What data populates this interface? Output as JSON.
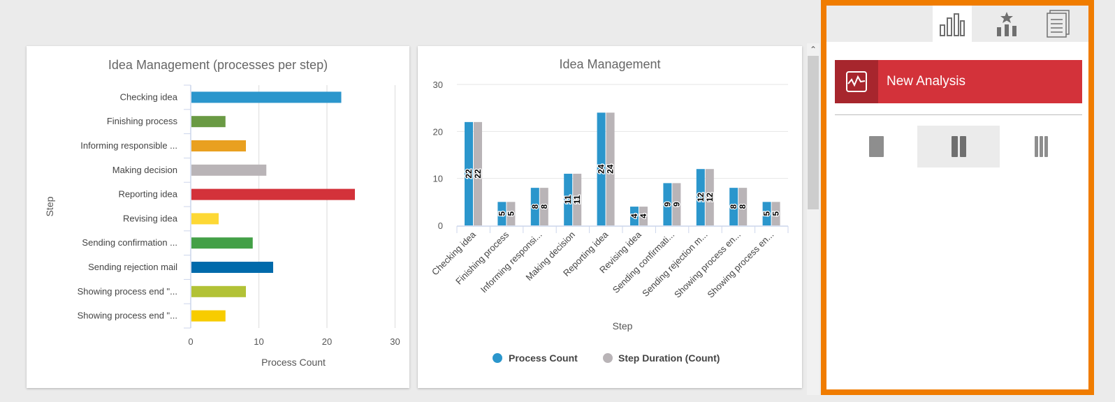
{
  "left_chart": {
    "title": "Idea Management (processes per step)",
    "xlabel": "Process Count",
    "ylabel": "Step",
    "xticks": [
      "0",
      "10",
      "20",
      "30"
    ]
  },
  "right_chart": {
    "title": "Idea Management",
    "xlabel": "Step",
    "yticks": [
      "0",
      "10",
      "20",
      "30"
    ],
    "legend": [
      "Process Count",
      "Step Duration (Count)"
    ]
  },
  "chart_data": [
    {
      "type": "bar",
      "orientation": "horizontal",
      "title": "Idea Management (processes per step)",
      "xlabel": "Process Count",
      "ylabel": "Step",
      "xlim": [
        0,
        30
      ],
      "grid": true,
      "categories": [
        "Checking idea",
        "Finishing process",
        "Informing responsible ...",
        "Making decision",
        "Reporting idea",
        "Revising idea",
        "Sending confirmation ...",
        "Sending rejection mail",
        "Showing process end \"...",
        "Showing process end \"..."
      ],
      "values": [
        22,
        5,
        8,
        11,
        24,
        4,
        9,
        12,
        8,
        5
      ],
      "colors": [
        "#2b96cc",
        "#6a9a44",
        "#e9a020",
        "#b9b4b7",
        "#d3323a",
        "#fdd835",
        "#43a047",
        "#006aab",
        "#b2c236",
        "#f7cc00"
      ]
    },
    {
      "type": "bar",
      "orientation": "vertical",
      "title": "Idea Management",
      "xlabel": "Step",
      "ylim": [
        0,
        30
      ],
      "grid": true,
      "legend_placement": "bottom",
      "categories": [
        "Checking idea",
        "Finishing process",
        "Informing responsi...",
        "Making decision",
        "Reporting idea",
        "Revising idea",
        "Sending confirmati...",
        "Sending rejection m...",
        "Showing process en...",
        "Showing process en..."
      ],
      "series": [
        {
          "name": "Process Count",
          "color": "#2b96cc",
          "values": [
            22,
            5,
            8,
            11,
            24,
            4,
            9,
            12,
            8,
            5
          ]
        },
        {
          "name": "Step Duration (Count)",
          "color": "#b9b4b7",
          "values": [
            22,
            5,
            8,
            11,
            24,
            4,
            9,
            12,
            8,
            5
          ]
        }
      ]
    }
  ],
  "panel": {
    "tabs": [
      {
        "icon": "bar-chart-icon",
        "active": true
      },
      {
        "icon": "ranking-star-icon",
        "active": false
      },
      {
        "icon": "documents-icon",
        "active": false
      }
    ],
    "new_analysis_label": "New Analysis",
    "layout_options": [
      {
        "icon": "one-column-icon",
        "active": false
      },
      {
        "icon": "two-column-icon",
        "active": true
      },
      {
        "icon": "three-column-icon",
        "active": false
      }
    ],
    "accent": "#f07c00",
    "button_color": "#d3323a"
  }
}
